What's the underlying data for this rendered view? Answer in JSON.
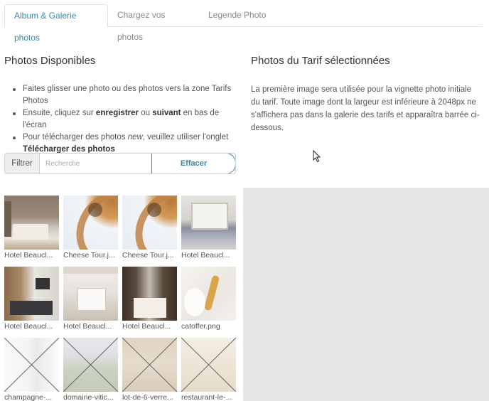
{
  "tabs": [
    {
      "label": "Album & Galerie photos",
      "active": true
    },
    {
      "label": "Chargez vos photos",
      "active": false
    },
    {
      "label": "Legende Photo",
      "active": false
    }
  ],
  "left": {
    "title": "Photos Disponibles",
    "instructions": {
      "item1": "Faites glisser une photo ou des photos vers la zone Tarifs Photos",
      "item2_prefix": "Ensuite, cliquez sur ",
      "item2_bold1": "enregistrer",
      "item2_mid": " ou ",
      "item2_bold2": "suivant",
      "item2_suffix": " en bas de l'écran",
      "item3_prefix": "Pour télécharger des photos ",
      "item3_italic": "new",
      "item3_mid": ", veuillez utiliser l'onglet ",
      "item3_bold": "Télécharger des photos"
    },
    "filter": {
      "label": "Filtrer",
      "placeholder": "Recherche",
      "clear_label": "Effacer"
    }
  },
  "right": {
    "title": "Photos du Tarif sélectionnées",
    "description": "La première image sera utilisée pour la vignette photo initiale du tarif. Toute image dont la largeur est inférieure à 2048px ne s'affichera pas dans la galerie des tarifs et apparaîtra barrée ci-dessous."
  },
  "photos": [
    {
      "caption": "Hotel Beaucl...",
      "thumb": "bedroom1",
      "crossed": false
    },
    {
      "caption": "Cheese Tour.j...",
      "thumb": "cheese",
      "crossed": false
    },
    {
      "caption": "Cheese Tour.j...",
      "thumb": "cheese",
      "crossed": false
    },
    {
      "caption": "Hotel Beaucl...",
      "thumb": "bedroom2",
      "crossed": false
    },
    {
      "caption": "Hotel Beaucl...",
      "thumb": "bedroom3",
      "crossed": false
    },
    {
      "caption": "Hotel Beaucl...",
      "thumb": "bedroom4",
      "crossed": false
    },
    {
      "caption": "Hotel Beaucl...",
      "thumb": "bedroom5",
      "crossed": false
    },
    {
      "caption": "catoffer.png",
      "thumb": "catoffer",
      "crossed": false
    },
    {
      "caption": "champagne-...",
      "thumb": "champ",
      "crossed": true
    },
    {
      "caption": "domaine-vitic...",
      "thumb": "domaine",
      "crossed": true
    },
    {
      "caption": "lot-de-6-verre...",
      "thumb": "verre",
      "crossed": true
    },
    {
      "caption": "restaurant-le-...",
      "thumb": "resto",
      "crossed": true
    }
  ],
  "colors": {
    "accent": "#3a88a8",
    "dropzone": "#e7e7e7"
  }
}
